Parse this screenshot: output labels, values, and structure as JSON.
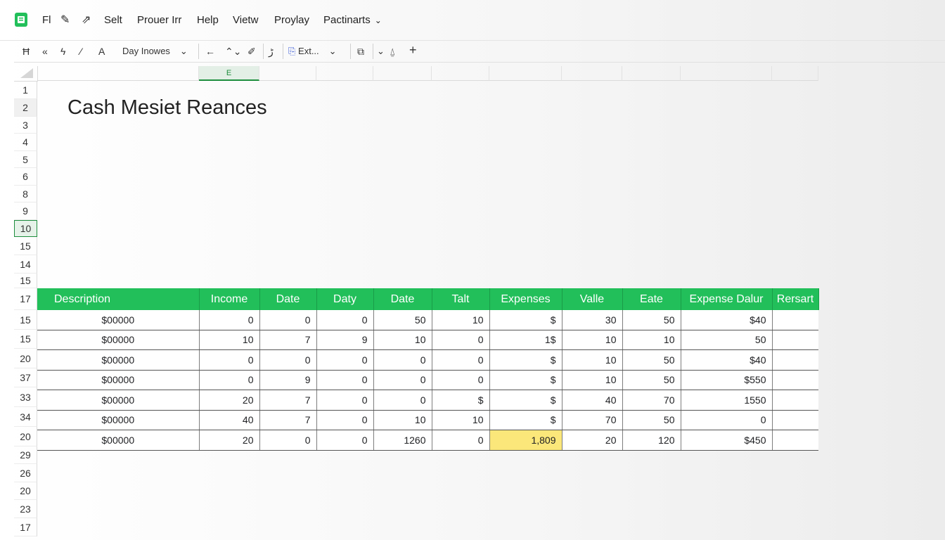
{
  "menu": {
    "items": [
      "Fl",
      "Selt",
      "Prouer Irr",
      "Help",
      "Vietw",
      "Proylay",
      "Pactinarts"
    ]
  },
  "toolbar": {
    "font_select": "Day Inowes",
    "ext_label": "Ext...",
    "icons": [
      "text-style-icon",
      "undo-icon",
      "format-icon",
      "brush-icon",
      "font-icon",
      "arrow-left-icon",
      "chart-up-icon",
      "pen-icon",
      "sparkle-icon",
      "paste-icon",
      "copy-icon",
      "fill-icon",
      "add-icon"
    ]
  },
  "column_header": {
    "active": "E"
  },
  "row_headers": {
    "top": [
      "1",
      "2",
      "3",
      "4",
      "5",
      "6",
      "8",
      "9",
      "10",
      "15",
      "14",
      "15"
    ],
    "active": "10",
    "table": [
      "17",
      "15",
      "15",
      "20",
      "37",
      "33",
      "34",
      "20"
    ],
    "bottom": [
      "29",
      "26",
      "20",
      "23",
      "17"
    ]
  },
  "sheet": {
    "title": "Cash Mesiet Reances",
    "columns": [
      "Description",
      "Income",
      "Date",
      "Daty",
      "Date",
      "Talt",
      "Expenses",
      "Valle",
      "Eate",
      "Expense Dalur",
      "Rersart"
    ],
    "rows": [
      [
        "$00000",
        "0",
        "0",
        "0",
        "50",
        "10",
        "$",
        "30",
        "50",
        "$40",
        ""
      ],
      [
        "$00000",
        "10",
        "7",
        "9",
        "10",
        "0",
        "1$",
        "10",
        "10",
        "50",
        ""
      ],
      [
        "$00000",
        "0",
        "0",
        "0",
        "0",
        "0",
        "$",
        "10",
        "50",
        "$40",
        ""
      ],
      [
        "$00000",
        "0",
        "9",
        "0",
        "0",
        "0",
        "$",
        "10",
        "50",
        "$550",
        ""
      ],
      [
        "$00000",
        "20",
        "7",
        "0",
        "0",
        "$",
        "$",
        "40",
        "70",
        "1550",
        ""
      ],
      [
        "$00000",
        "40",
        "7",
        "0",
        "10",
        "10",
        "$",
        "70",
        "50",
        "0",
        ""
      ],
      [
        "$00000",
        "20",
        "0",
        "0",
        "1260",
        "0",
        "1,809",
        "20",
        "120",
        "$450",
        ""
      ]
    ],
    "highlight": {
      "row": 6,
      "col": 6,
      "color": "#fbe77a"
    }
  },
  "colors": {
    "header_green": "#22bf5a",
    "accent": "#1e8e3e",
    "highlight": "#fbe77a"
  }
}
